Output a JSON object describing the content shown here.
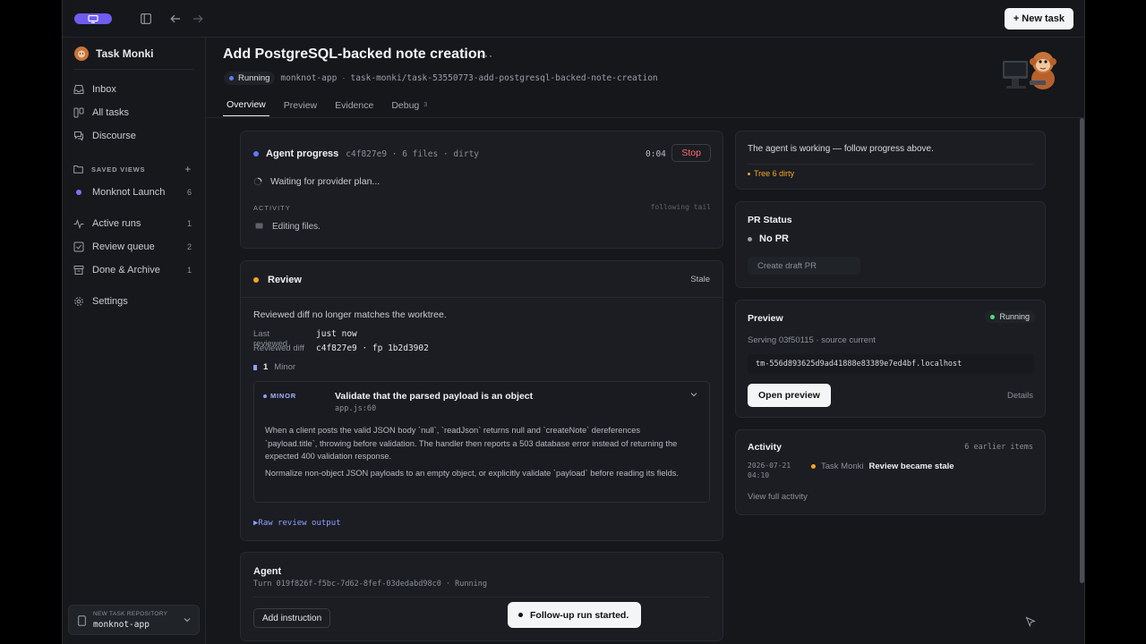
{
  "topbar": {
    "new_task_label": "+ New task"
  },
  "sidebar": {
    "brand": "Task Monki",
    "nav": [
      {
        "label": "Inbox"
      },
      {
        "label": "All tasks"
      },
      {
        "label": "Discourse"
      }
    ],
    "saved_views_label": "SAVED VIEWS",
    "saved_add": "+",
    "saved": [
      {
        "label": "Monknot Launch",
        "count": "6",
        "color": "#8b6cf6"
      }
    ],
    "queues": [
      {
        "label": "Active runs",
        "count": "1"
      },
      {
        "label": "Review queue",
        "count": "2"
      },
      {
        "label": "Done & Archive",
        "count": "1"
      }
    ],
    "settings_label": "Settings",
    "repo": {
      "label": "NEW TASK REPOSITORY",
      "value": "monknot-app"
    }
  },
  "header": {
    "title": "Add PostgreSQL-backed note creation",
    "more": "···",
    "status": "Running",
    "repo": "monknot-app",
    "sep": "·",
    "branch": "task-monki/task-53550773-add-postgresql-backed-note-creation",
    "tabs": [
      {
        "label": "Overview"
      },
      {
        "label": "Preview"
      },
      {
        "label": "Evidence"
      },
      {
        "label": "Debug",
        "badge": "3"
      }
    ]
  },
  "agent_progress": {
    "title": "Agent progress",
    "meta": "c4f827e9 · 6 files · dirty",
    "elapsed": "0:04",
    "stop_label": "Stop",
    "waiting": "Waiting for provider plan...",
    "activity_label": "ACTIVITY",
    "following": "following tail",
    "activity_item": "Editing files."
  },
  "review": {
    "title": "Review",
    "state": "Stale",
    "message": "Reviewed diff no longer matches the worktree.",
    "last_reviewed_label": "Last reviewed",
    "last_reviewed_value": "just now",
    "reviewed_diff_label": "Reviewed diff",
    "reviewed_diff_value": "c4f827e9 · fp 1b2d3902",
    "count": "1",
    "count_label": "Minor",
    "finding": {
      "severity": "MINOR",
      "title": "Validate that the parsed payload is an object",
      "location": "app.js:60",
      "body1": "When a client posts the valid JSON body `null`, `readJson` returns null and `createNote` dereferences `payload.title`, throwing before validation. The handler then reports a 503 database error instead of returning the expected 400 validation response.",
      "body2": "Normalize non-object JSON payloads to an empty object, or explicitly validate `payload` before reading its fields."
    },
    "raw_output": "▶Raw review output"
  },
  "agent": {
    "title": "Agent",
    "turn": "Turn 019f826f-f5bc-7d62-8fef-03dedabd98c0 · Running",
    "add_instruction": "Add instruction"
  },
  "right": {
    "working_msg": "The agent is working — follow progress above.",
    "tree": "Tree 6 dirty",
    "pr_title": "PR Status",
    "pr_state": "No PR",
    "create_pr": "Create draft PR",
    "preview_title": "Preview",
    "preview_status": "Running",
    "serving": "Serving 03f50115 · source current",
    "url": "tm-556d893625d9ad41888e83389e7ed4bf.localhost",
    "open_preview": "Open preview",
    "details": "Details",
    "activity_title": "Activity",
    "earlier": "6 earlier items",
    "act_date": "2026-07-21",
    "act_time": "04:10",
    "act_actor": "Task Monki",
    "act_text": "Review became stale",
    "view_full": "View full activity"
  },
  "toast": "Follow-up run started.",
  "colors": {
    "accent": "#6f5cf0",
    "running": "#4ade80",
    "warning": "#f5a524",
    "danger": "#ff6b6b",
    "minor": "#a9b4ff"
  }
}
